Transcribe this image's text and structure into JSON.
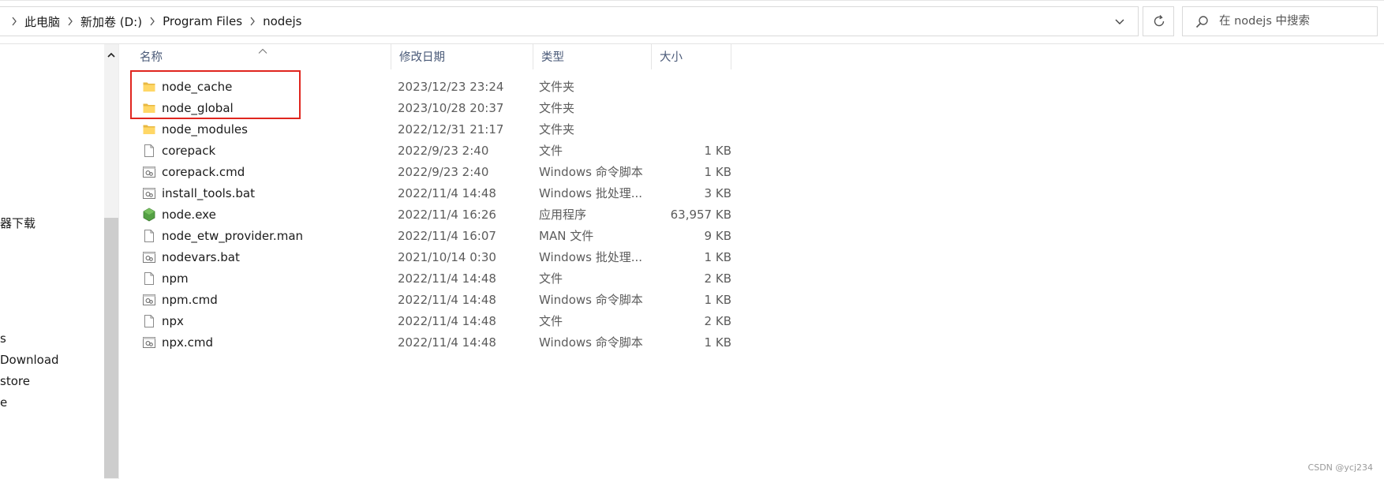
{
  "breadcrumb": [
    "此电脑",
    "新加卷 (D:)",
    "Program Files",
    "nodejs"
  ],
  "search": {
    "placeholder": "在 nodejs 中搜索"
  },
  "nav": {
    "items": [
      "器下载",
      "s",
      "Download",
      "store",
      "e"
    ]
  },
  "columns": {
    "name": "名称",
    "date": "修改日期",
    "type": "类型",
    "size": "大小"
  },
  "files": [
    {
      "name": "node_cache",
      "date": "2023/12/23 23:24",
      "type": "文件夹",
      "size": "",
      "icon": "folder-icon"
    },
    {
      "name": "node_global",
      "date": "2023/10/28 20:37",
      "type": "文件夹",
      "size": "",
      "icon": "folder-icon"
    },
    {
      "name": "node_modules",
      "date": "2022/12/31 21:17",
      "type": "文件夹",
      "size": "",
      "icon": "folder-icon"
    },
    {
      "name": "corepack",
      "date": "2022/9/23 2:40",
      "type": "文件",
      "size": "1 KB",
      "icon": "file-icon"
    },
    {
      "name": "corepack.cmd",
      "date": "2022/9/23 2:40",
      "type": "Windows 命令脚本",
      "size": "1 KB",
      "icon": "script-icon"
    },
    {
      "name": "install_tools.bat",
      "date": "2022/11/4 14:48",
      "type": "Windows 批处理...",
      "size": "3 KB",
      "icon": "script-icon"
    },
    {
      "name": "node.exe",
      "date": "2022/11/4 16:26",
      "type": "应用程序",
      "size": "63,957 KB",
      "icon": "node-app-icon"
    },
    {
      "name": "node_etw_provider.man",
      "date": "2022/11/4 16:07",
      "type": "MAN 文件",
      "size": "9 KB",
      "icon": "file-icon"
    },
    {
      "name": "nodevars.bat",
      "date": "2021/10/14 0:30",
      "type": "Windows 批处理...",
      "size": "1 KB",
      "icon": "script-icon"
    },
    {
      "name": "npm",
      "date": "2022/11/4 14:48",
      "type": "文件",
      "size": "2 KB",
      "icon": "file-icon"
    },
    {
      "name": "npm.cmd",
      "date": "2022/11/4 14:48",
      "type": "Windows 命令脚本",
      "size": "1 KB",
      "icon": "script-icon"
    },
    {
      "name": "npx",
      "date": "2022/11/4 14:48",
      "type": "文件",
      "size": "2 KB",
      "icon": "file-icon"
    },
    {
      "name": "npx.cmd",
      "date": "2022/11/4 14:48",
      "type": "Windows 命令脚本",
      "size": "1 KB",
      "icon": "script-icon"
    }
  ],
  "highlight_color": "#e0261f",
  "watermark": "CSDN @ycj234"
}
